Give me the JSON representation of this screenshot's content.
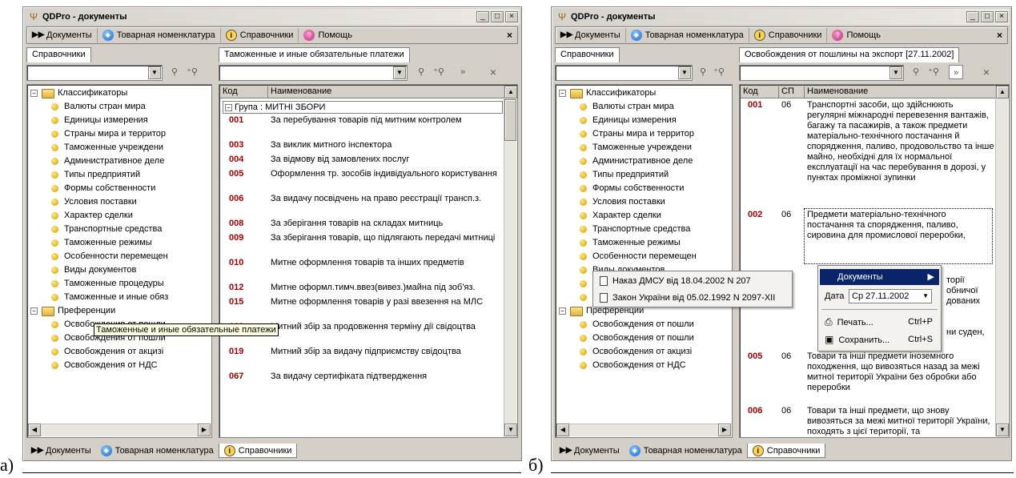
{
  "captions": {
    "a": "а)",
    "b": "б)"
  },
  "w1": {
    "title": "QDPro - документы",
    "toolbar": {
      "docs": "Документы",
      "nomen": "Товарная номенклатура",
      "refs": "Справочники",
      "help": "Помощь"
    },
    "left_tab": "Справочники",
    "right_tab": "Таможенные и иные обязательные платежи",
    "tree": {
      "root1": "Классификаторы",
      "items1": [
        "Валюты стран мира",
        "Единицы измерения",
        "Страны мира и территор",
        "Таможенные учреждени",
        "Административное деле",
        "Типы предприятий",
        "Формы собственности",
        "Условия поставки",
        "Характер сделки",
        "Транспортные средства",
        "Таможенные режимы",
        "Особенности перемещен",
        "Виды документов",
        "Таможенные процедуры",
        "Таможенные и иные обяз"
      ],
      "root2": "Преференции",
      "items2": [
        "Освобождения от пошли",
        "Освобождения от пошли",
        "Освобождения от акцизі",
        "Освобождения от НДС"
      ]
    },
    "tooltip": "Таможенные и иные обязательные платежи",
    "grid": {
      "col_code": "Код",
      "col_name": "Наименование",
      "group": "Група : МИТНІ ЗБОРИ",
      "rows": [
        {
          "code": "001",
          "name": "За перебування товарів під митним контролем"
        },
        {
          "code": "003",
          "name": "За виклик митного інспектора"
        },
        {
          "code": "004",
          "name": "За відмову від замовлених послуг"
        },
        {
          "code": "005",
          "name": "Оформлення тр. зособів індивідуального користування"
        },
        {
          "code": "006",
          "name": "За видачу посвідчень на право реєстрації трансп.з."
        },
        {
          "code": "008",
          "name": "За зберігання товарів на складах митниць"
        },
        {
          "code": "009",
          "name": "За зберігання товарів, що підлягають передачі митниці"
        },
        {
          "code": "010",
          "name": "Митне оформлення товарів та інших предметів"
        },
        {
          "code": "012",
          "name": "Митне оформл.тимч.ввез(вивез.)майна під зоб'яз."
        },
        {
          "code": "015",
          "name": "Митне оформлення товарів у разі ввезення на МЛС"
        },
        {
          "code": "018",
          "name": "Митний збір за продовження терміну дії свідоцтва"
        },
        {
          "code": "019",
          "name": "Митний збір за видачу підприємству свідоцтва"
        },
        {
          "code": "067",
          "name": "За видачу сертифіката підтвердження"
        }
      ]
    },
    "bottom": {
      "docs": "Документы",
      "nomen": "Товарная номенклатура",
      "refs": "Справочники"
    }
  },
  "w2": {
    "title": "QDPro - документы",
    "toolbar": {
      "docs": "Документы",
      "nomen": "Товарная номенклатура",
      "refs": "Справочники",
      "help": "Помощь"
    },
    "left_tab": "Справочники",
    "right_tab": "Освобождения от пошлины на экспорт [27.11.2002]",
    "tree": {
      "root1": "Классификаторы",
      "items1": [
        "Валюты стран мира",
        "Единицы измерения",
        "Страны мира и территор",
        "Таможенные учреждени",
        "Административное деле",
        "Типы предприятий",
        "Формы собственности",
        "Условия поставки",
        "Характер сделки",
        "Транспортные средства",
        "Таможенные режимы",
        "Особенности перемещен",
        "Виды документов",
        "Таможенные процедуры",
        "Таможенные и иные обя"
      ],
      "root2": "Преференции",
      "items2": [
        "Освобождения от пошли",
        "Освобождения от пошли",
        "Освобождения от акцизі",
        "Освобождения от НДС"
      ]
    },
    "grid": {
      "col_code": "Код",
      "col_sp": "СП",
      "col_name": "Наименование",
      "rows": [
        {
          "code": "001",
          "sp": "06",
          "name": "Транспортні засоби, що здійснюють регулярні міжнародні перевезення вантажів, багажу та пасажирів, а також предмети матеріально-технічного постачання й спорядження, паливо, продовольство та інше майно, необхідні для їх нормальної експлуатації на час перебування в дорозі, у пунктах проміжної зупинки"
        },
        {
          "code": "002",
          "sp": "06",
          "name": "Предмети матеріально-технічного постачання та спорядження, паливо, сировина для промислової переробки,"
        },
        {
          "code": "005",
          "sp": "06",
          "name": "Товари та інші предмети іноземного походження, що вивозяться назад за межі митної території України без обробки або переробки"
        },
        {
          "code": "006",
          "sp": "06",
          "name": "Товари та інші предмети, що знову вивозяться за межі митної території України, походять з цієї території, та"
        }
      ],
      "peek": [
        "торії",
        "обничої",
        "дованих",
        "ни суден,"
      ]
    },
    "ctx": {
      "docs": "Документы",
      "date_label": "Дата",
      "date_value": "Ср 27.11.2002",
      "print": "Печать...",
      "print_key": "Ctrl+P",
      "save": "Сохранить...",
      "save_key": "Ctrl+S"
    },
    "submenu": [
      "Наказ ДМСУ від 18.04.2002 N 207",
      "Закон України від 05.02.1992 N 2097-XII"
    ],
    "bottom": {
      "docs": "Документы",
      "nomen": "Товарная номенклатура",
      "refs": "Справочники"
    }
  }
}
